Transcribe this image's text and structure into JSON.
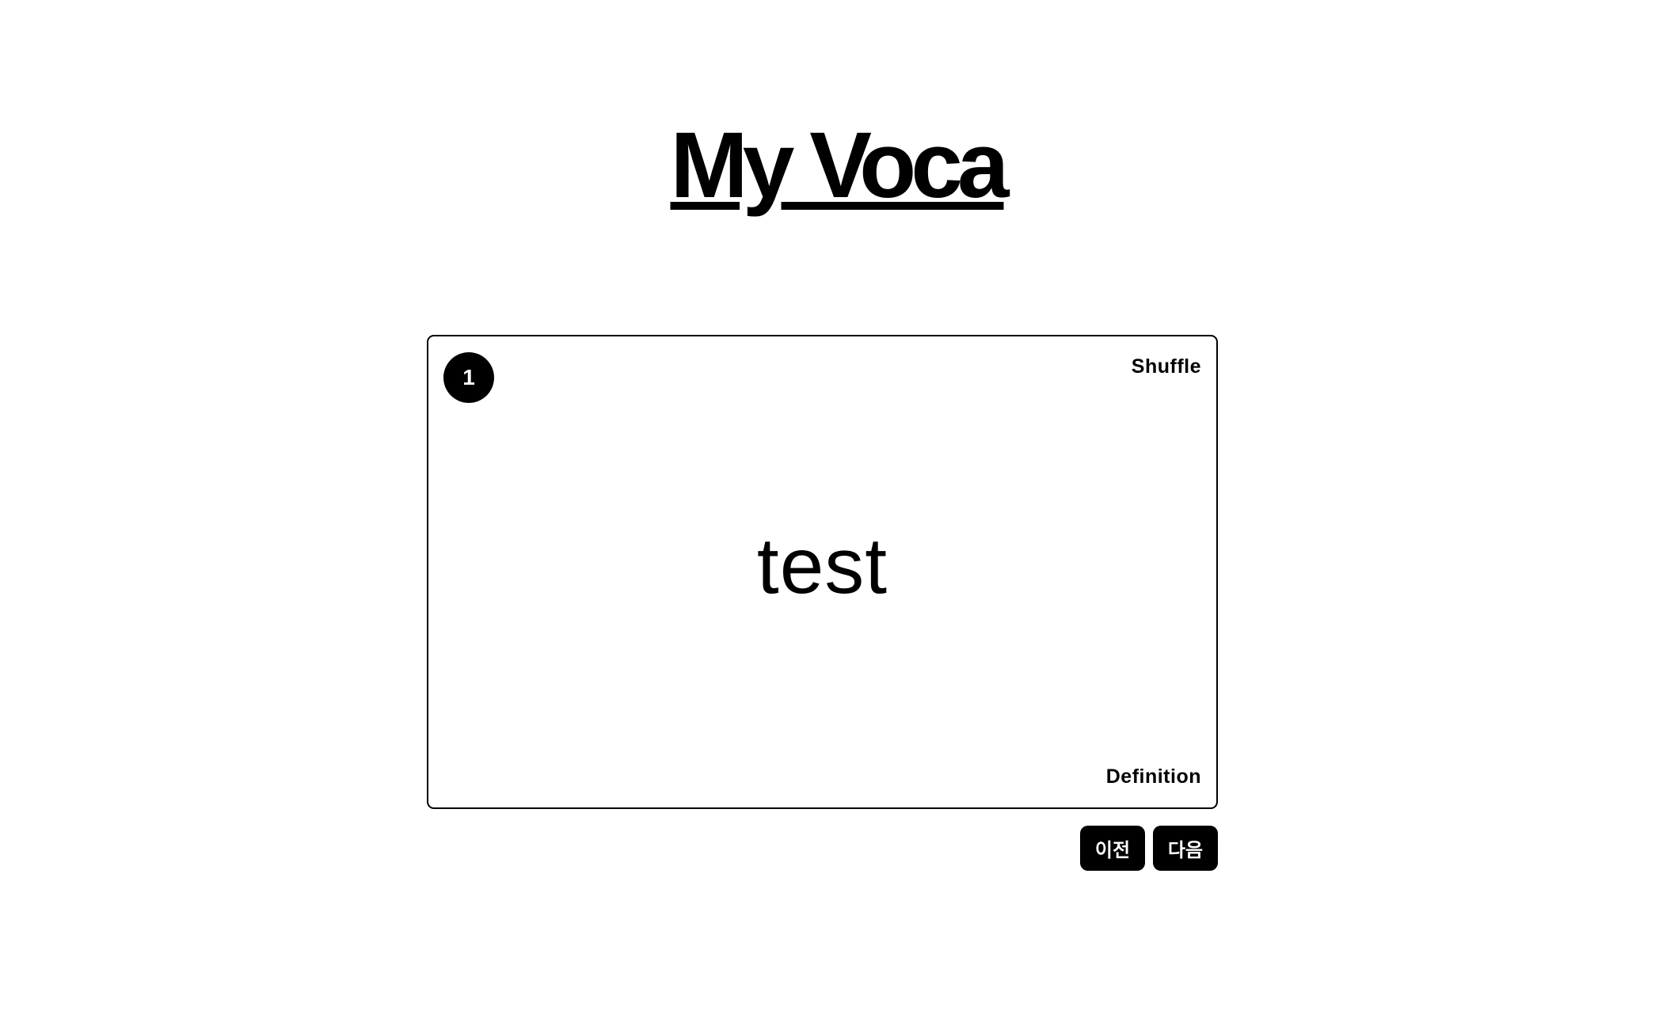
{
  "header": {
    "title": "My Voca"
  },
  "card": {
    "index": "1",
    "shuffle_label": "Shuffle",
    "word": "test",
    "definition_label": "Definition"
  },
  "navigation": {
    "prev_label": "이전",
    "next_label": "다음"
  },
  "colors": {
    "background": "#ffffff",
    "accent": "#000000",
    "button_text": "#ffffff"
  }
}
